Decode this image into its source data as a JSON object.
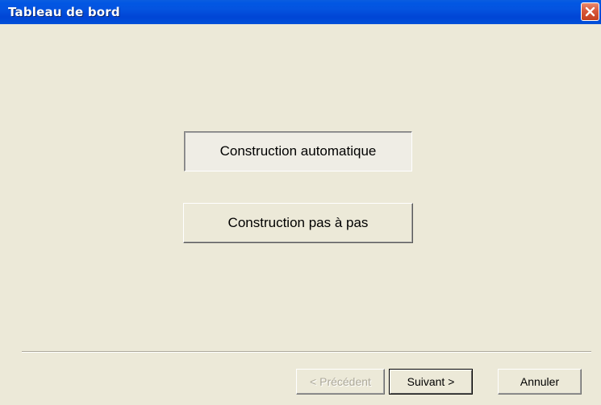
{
  "window": {
    "title": "Tableau de bord",
    "close_icon": "close-x-icon"
  },
  "main": {
    "auto_build_label": "Construction automatique",
    "step_build_label": "Construction pas à pas"
  },
  "footer": {
    "prev_label": "< Précédent",
    "prev_enabled": false,
    "next_label": "Suivant >",
    "cancel_label": "Annuler"
  },
  "colors": {
    "titlebar": "#0053E0",
    "dialog_background": "#ECE9D8",
    "close_button": "#D8573A",
    "disabled_text": "#ACA899"
  }
}
